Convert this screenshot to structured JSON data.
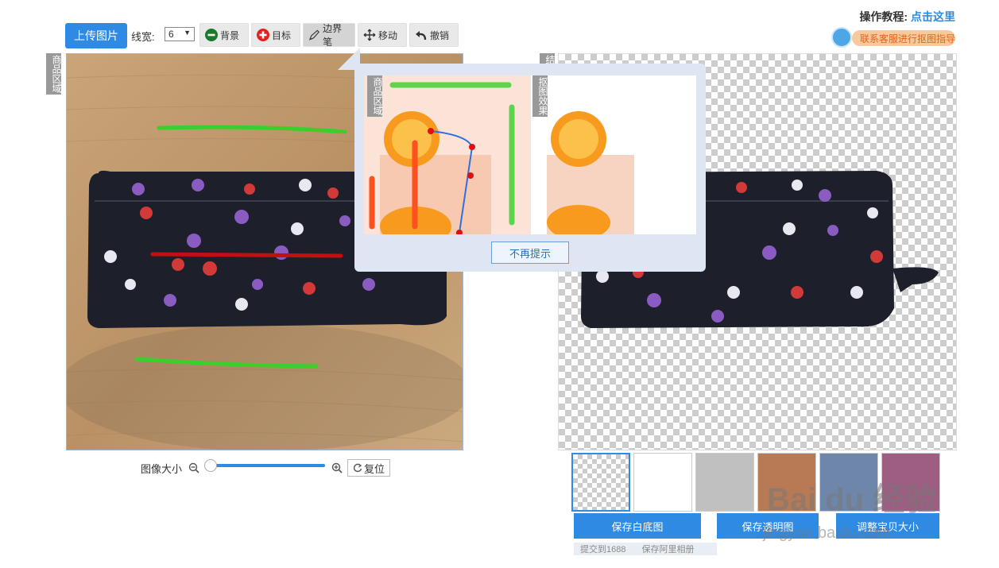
{
  "toolbar": {
    "upload_label": "上传图片",
    "line_width_label": "线宽:",
    "line_width_value": "6",
    "tools": [
      {
        "label": "背景",
        "icon": "minus-circle-icon"
      },
      {
        "label": "目标",
        "icon": "plus-circle-icon"
      },
      {
        "label": "边界笔",
        "icon": "pen-icon"
      },
      {
        "label": "移动",
        "icon": "move-icon"
      },
      {
        "label": "撤销",
        "icon": "undo-icon"
      }
    ]
  },
  "tutorial": {
    "label": "操作教程:",
    "link": "点击这里",
    "contact": "联系客服进行抠图指导"
  },
  "left_panel": {
    "region_label": "商品区域"
  },
  "right_panel": {
    "region_label": "结"
  },
  "popup": {
    "left_label": "商品区域",
    "right_label": "抠图效果",
    "dismiss_label": "不再提示"
  },
  "zoom": {
    "label": "图像大小",
    "level": 0,
    "reset_label": "复位"
  },
  "swatches": {
    "colors": [
      "transparent",
      "#ffffff",
      "#c0c0c0",
      "#b87a55",
      "#6e86aa",
      "#9e5d82"
    ],
    "selected": 0
  },
  "actions": {
    "save_white": "保存白底图",
    "save_transparent": "保存透明图",
    "adjust_size": "调整宝贝大小",
    "submit_1688": "提交到1688",
    "save_album": "保存阿里相册"
  },
  "watermark": {
    "text": "Bai du 经验",
    "url": "jingyan.baidu.com"
  }
}
